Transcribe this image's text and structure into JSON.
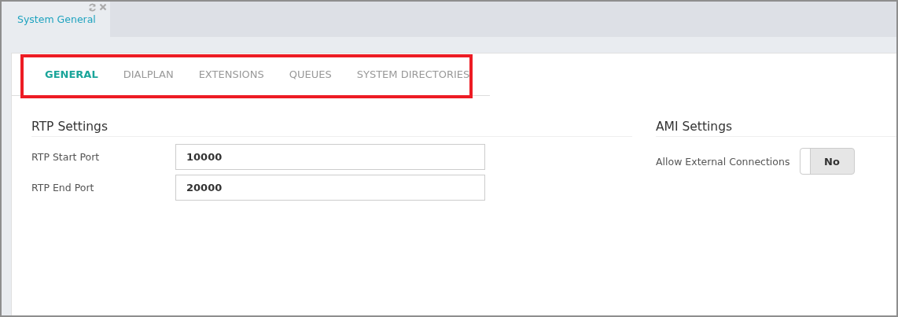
{
  "window_tab": {
    "title": "System General"
  },
  "tabs": [
    {
      "label": "GENERAL",
      "selected": true
    },
    {
      "label": "DIALPLAN",
      "selected": false
    },
    {
      "label": "EXTENSIONS",
      "selected": false
    },
    {
      "label": "QUEUES",
      "selected": false
    },
    {
      "label": "SYSTEM DIRECTORIES",
      "selected": false
    }
  ],
  "rtp_settings": {
    "title": "RTP Settings",
    "fields": [
      {
        "label": "RTP Start Port",
        "value": "10000"
      },
      {
        "label": "RTP End Port",
        "value": "20000"
      }
    ]
  },
  "ami_settings": {
    "title": "AMI Settings",
    "toggle": {
      "label": "Allow External Connections",
      "on": false,
      "text": "No"
    }
  }
}
